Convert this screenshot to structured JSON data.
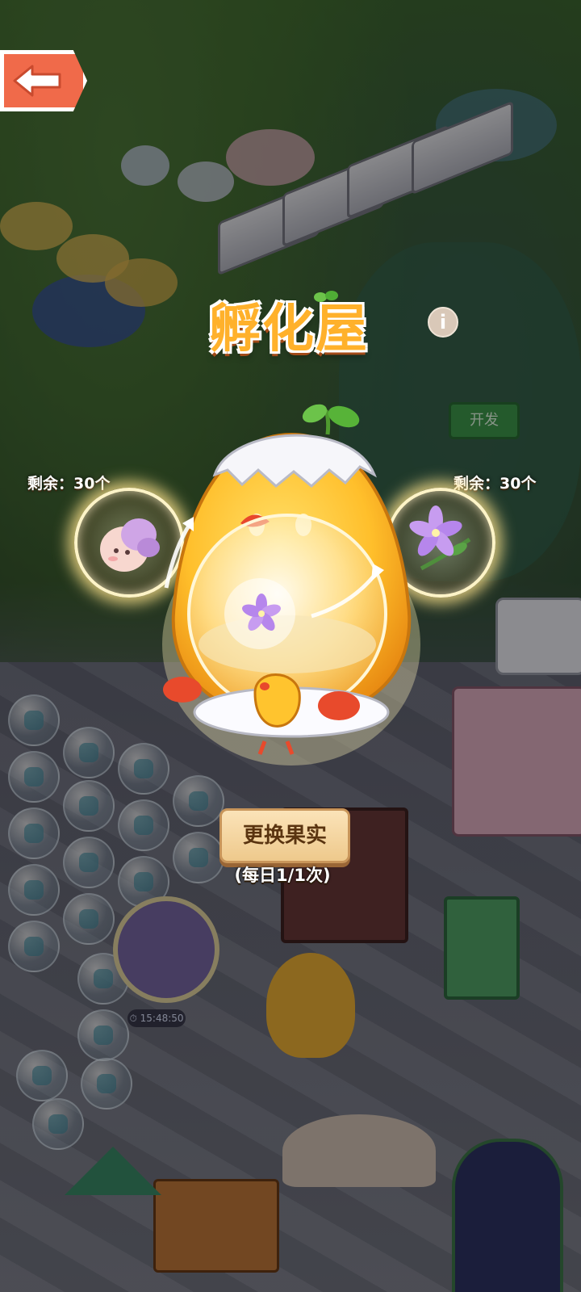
{
  "title": "孵化屋",
  "left_slot": {
    "remaining": "剩余：30个",
    "item_icon": "flower-creature-icon"
  },
  "right_slot": {
    "remaining": "剩余：30个",
    "item_icon": "purple-flower-icon"
  },
  "incubator_icon": "chick-incubator-icon",
  "swap_button": {
    "label": "更换果实"
  },
  "daily_limit": "(每日1/1次)",
  "background": {
    "sign_label": "开发",
    "timer": "15:48:50"
  },
  "colors": {
    "back_button": "#f06a4a",
    "title": "#ffb12b",
    "swap_button": "#f3d39e",
    "incubator": "#ffbf2b"
  }
}
